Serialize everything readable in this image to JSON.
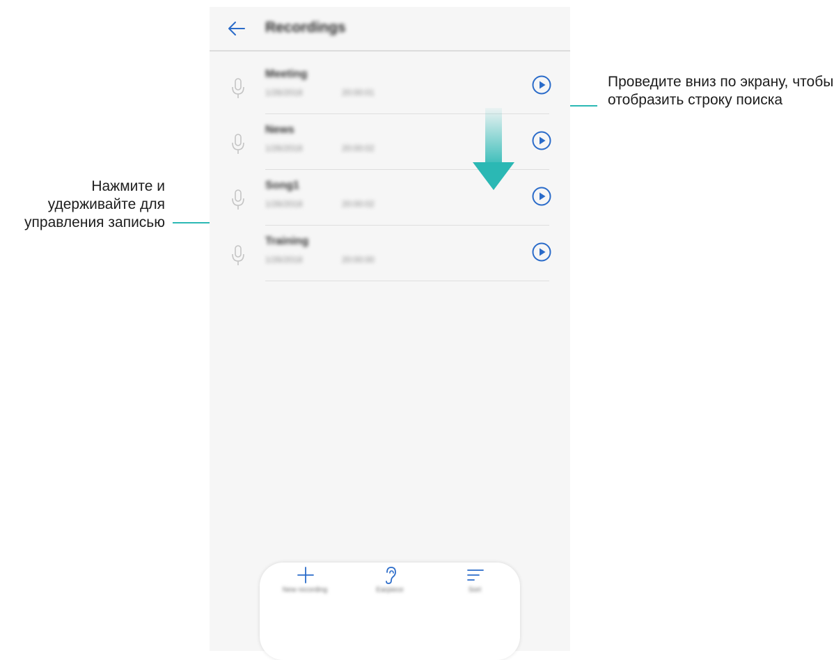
{
  "app": {
    "title": "Recordings",
    "accent_color": "#2a6bc9",
    "callout_color": "#2bb8b4"
  },
  "recordings": [
    {
      "name": "Meeting",
      "date": "1/26/2018",
      "time": "20:00:01",
      "play_icon": "play-icon"
    },
    {
      "name": "News",
      "date": "1/26/2018",
      "time": "20:00:02",
      "play_icon": "play-icon"
    },
    {
      "name": "Song1",
      "date": "1/26/2018",
      "time": "20:00:02",
      "play_icon": "play-icon"
    },
    {
      "name": "Training",
      "date": "1/26/2018",
      "time": "20:00:00",
      "play_icon": "play-icon"
    }
  ],
  "bottom_bar": {
    "new_recording": "New recording",
    "earpiece": "Earpiece",
    "sort": "Sort"
  },
  "callouts": {
    "left": "Нажмите и удерживайте для управления записью",
    "right": "Проведите вниз по экрану, чтобы отобразить строку поиска"
  }
}
